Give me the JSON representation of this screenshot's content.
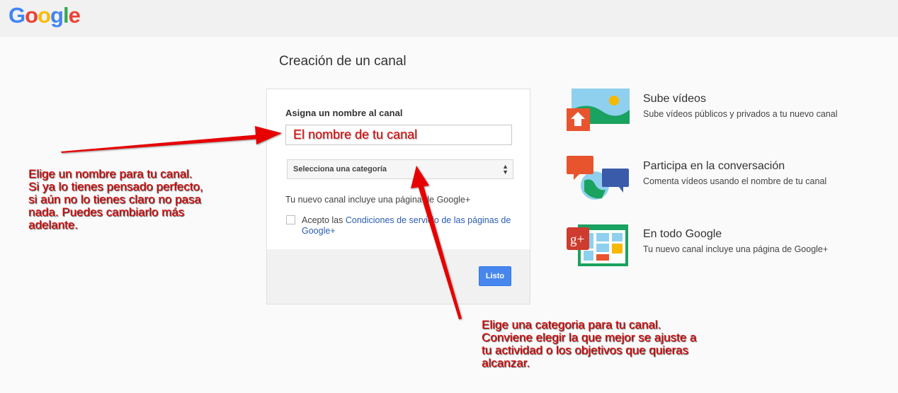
{
  "header": {
    "logo_letters": [
      "G",
      "o",
      "o",
      "g",
      "l",
      "e"
    ]
  },
  "main": {
    "title": "Creación de un canal",
    "form": {
      "name_label": "Asigna un nombre al canal",
      "name_value": "El nombre de tu canal",
      "category_placeholder": "Selecciona una categoría",
      "includes_text": "Tu nuevo canal incluye una página de Google+",
      "terms_prefix": "Acepto las",
      "terms_link": "Condiciones de servicio de las páginas de Google+",
      "terms_checked": false,
      "submit_label": "Listo"
    }
  },
  "features": [
    {
      "title": "Sube vídeos",
      "desc": "Sube vídeos públicos y privados a tu nuevo canal",
      "icon": "upload-illustration-icon"
    },
    {
      "title": "Participa en la conversación",
      "desc": "Comenta vídeos usando el nombre de tu canal",
      "icon": "conversation-illustration-icon"
    },
    {
      "title": "En todo Google",
      "desc": "Tu nuevo canal incluye una página de Google+",
      "icon": "google-plus-illustration-icon"
    }
  ],
  "annotations": {
    "left": [
      "Elige un nombre para tu canal.",
      "Si ya lo tienes pensado perfecto,",
      "si aún no lo tienes claro no pasa",
      "nada. Puedes cambiarlo más",
      "adelante."
    ],
    "right": [
      "Elige una categoria para tu canal.",
      "Conviene elegir la que mejor se ajuste a",
      "tu actividad o los objetivos que quieras",
      "alcanzar."
    ]
  },
  "colors": {
    "annotation": "#e60000",
    "button": "#4787ed",
    "link": "#2a5db0"
  }
}
